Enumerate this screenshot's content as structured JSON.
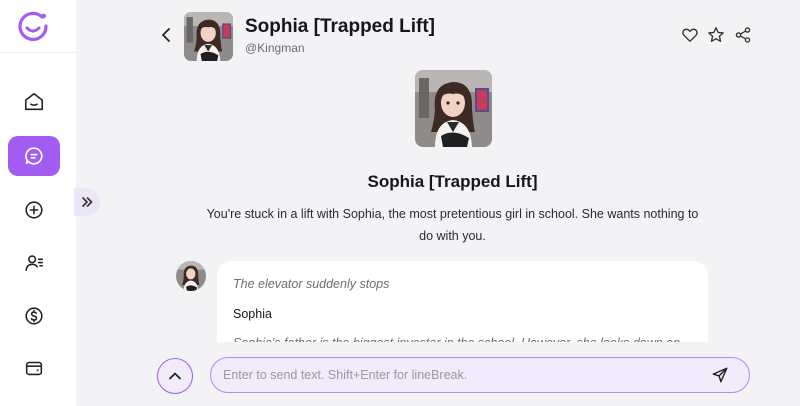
{
  "app": {
    "logo_icon": "brand-logo-icon",
    "accent_color": "#a35cf2"
  },
  "sidebar": {
    "items": [
      {
        "icon": "home-icon",
        "active": false
      },
      {
        "icon": "chat-icon",
        "active": true
      },
      {
        "icon": "plus-circle-icon",
        "active": false
      },
      {
        "icon": "user-list-icon",
        "active": false
      },
      {
        "icon": "dollar-icon",
        "active": false
      },
      {
        "icon": "wallet-icon",
        "active": false
      }
    ],
    "expand_icon": "double-chevron-right-icon"
  },
  "header": {
    "title": "Sophia [Trapped Lift]",
    "handle": "@Kingman",
    "actions": [
      "heart-icon",
      "star-icon",
      "share-icon"
    ]
  },
  "intro": {
    "title": "Sophia [Trapped Lift]",
    "description": "You're stuck in a lift with Sophia, the most pretentious girl in school. She wants nothing to do with you."
  },
  "messages": [
    {
      "narration": "The elevator suddenly stops",
      "speaker": "Sophia",
      "text": "Sophia's father is the biggest investor in the school. However, she looks down on"
    }
  ],
  "composer": {
    "placeholder": "Enter to send text. Shift+Enter for lineBreak.",
    "value": ""
  }
}
